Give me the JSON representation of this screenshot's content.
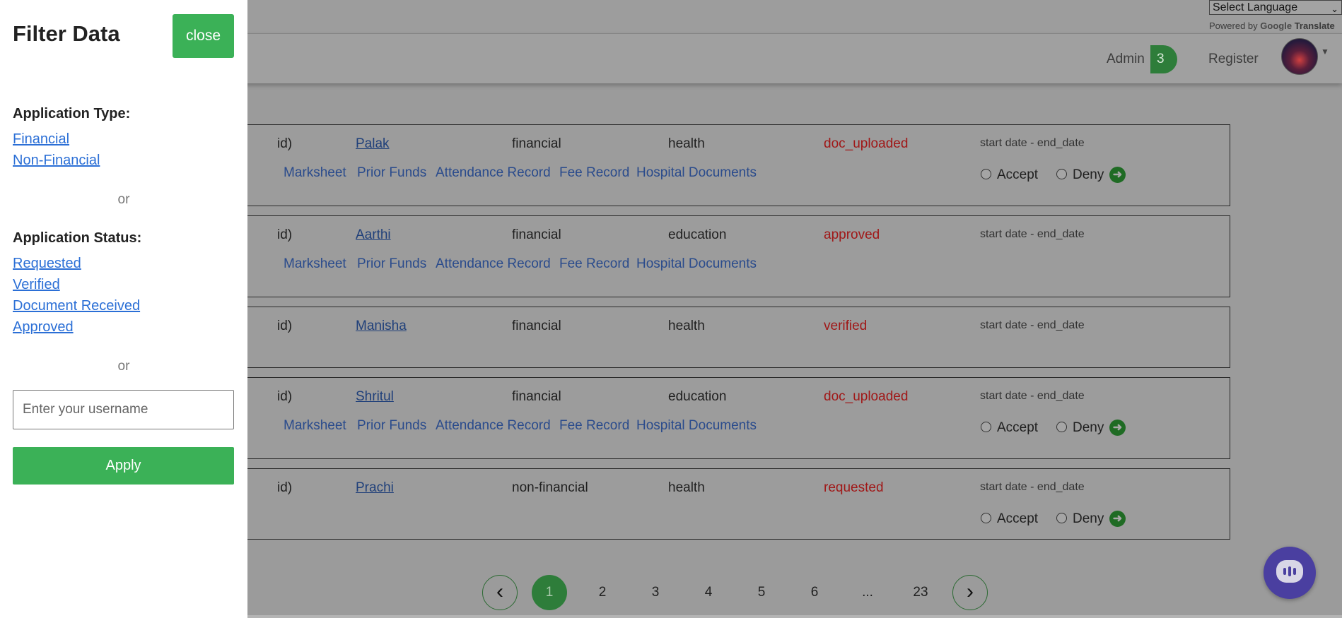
{
  "language_widget": {
    "select_value": "Select Language",
    "powered_by": "Powered by",
    "google": "Google",
    "translate": "Translate"
  },
  "navbar": {
    "admin_label": "Admin",
    "admin_badge": "3",
    "register_label": "Register"
  },
  "applications": [
    {
      "id": "id)",
      "name": "Palak",
      "type": "financial",
      "category": "health",
      "status": "doc_uploaded",
      "dates": "start date - end_date",
      "documents": [
        "Marksheet",
        "Prior Funds",
        "Attendance Record",
        "Fee Record",
        "Hospital Documents"
      ],
      "actions": {
        "accept": "Accept",
        "deny": "Deny"
      }
    },
    {
      "id": "id)",
      "name": "Aarthi",
      "type": "financial",
      "category": "education",
      "status": "approved",
      "dates": "start date - end_date",
      "documents": [
        "Marksheet",
        "Prior Funds",
        "Attendance Record",
        "Fee Record",
        "Hospital Documents"
      ]
    },
    {
      "id": "id)",
      "name": "Manisha",
      "type": "financial",
      "category": "health",
      "status": "verified",
      "dates": "start date - end_date"
    },
    {
      "id": "id)",
      "name": "Shritul",
      "type": "financial",
      "category": "education",
      "status": "doc_uploaded",
      "dates": "start date - end_date",
      "documents": [
        "Marksheet",
        "Prior Funds",
        "Attendance Record",
        "Fee Record",
        "Hospital Documents"
      ],
      "actions": {
        "accept": "Accept",
        "deny": "Deny"
      }
    },
    {
      "id": "id)",
      "name": "Prachi",
      "type": "non-financial",
      "category": "health",
      "status": "requested",
      "dates": "start date - end_date",
      "actions": {
        "accept": "Accept",
        "deny": "Deny"
      }
    }
  ],
  "pagination": {
    "prev_icon": "chevron-left-icon",
    "next_icon": "chevron-right-icon",
    "pages": [
      "1",
      "2",
      "3",
      "4",
      "5",
      "6",
      "...",
      "23"
    ],
    "current": "1"
  },
  "filter_panel": {
    "title": "Filter Data",
    "close_label": "close",
    "application_type_label": "Application Type:",
    "application_types": [
      "Financial",
      "Non-Financial"
    ],
    "or_1": "or",
    "application_status_label": "Application Status:",
    "application_statuses": [
      "Requested",
      "Verified",
      "Document Received",
      "Approved"
    ],
    "or_2": "or",
    "username_placeholder": "Enter your username",
    "apply_label": "Apply"
  },
  "colors": {
    "accent_green": "#3bb157",
    "link_blue": "#2b6fd6",
    "status_red": "#a01818",
    "chat_purple": "#4a3fa0"
  }
}
